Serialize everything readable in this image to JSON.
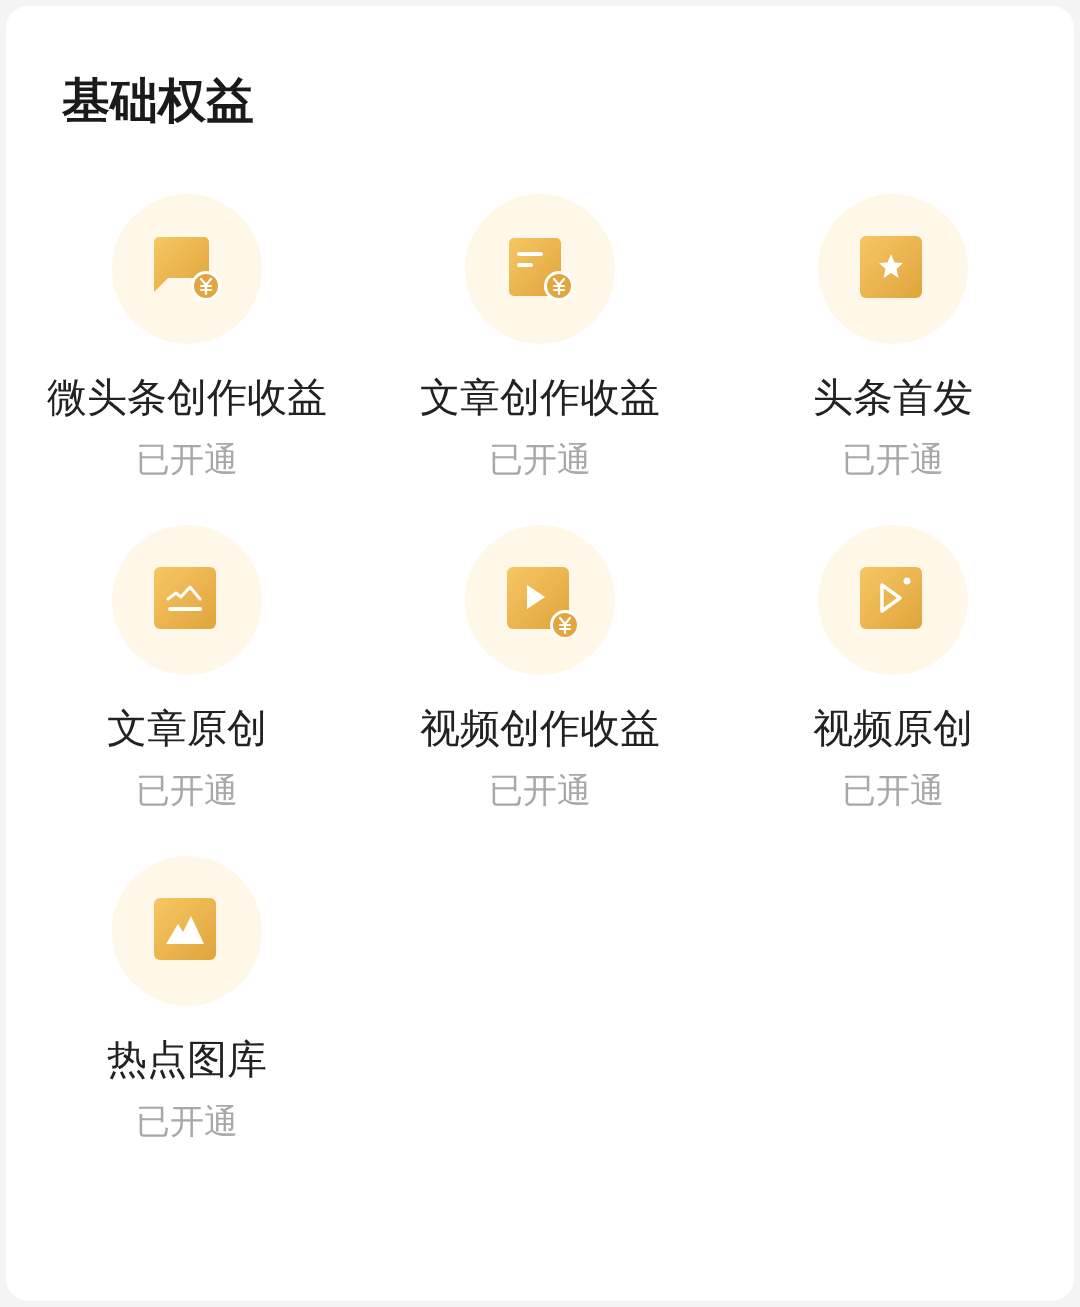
{
  "section_title": "基础权益",
  "benefits": [
    {
      "kind": "chat_coin",
      "title": "微头条创作收益",
      "status": "已开通"
    },
    {
      "kind": "doc_coin",
      "title": "文章创作收益",
      "status": "已开通"
    },
    {
      "kind": "star",
      "title": "头条首发",
      "status": "已开通"
    },
    {
      "kind": "chart",
      "title": "文章原创",
      "status": "已开通"
    },
    {
      "kind": "video_coin",
      "title": "视频创作收益",
      "status": "已开通"
    },
    {
      "kind": "play",
      "title": "视频原创",
      "status": "已开通"
    },
    {
      "kind": "mountain",
      "title": "热点图库",
      "status": "已开通"
    }
  ]
}
